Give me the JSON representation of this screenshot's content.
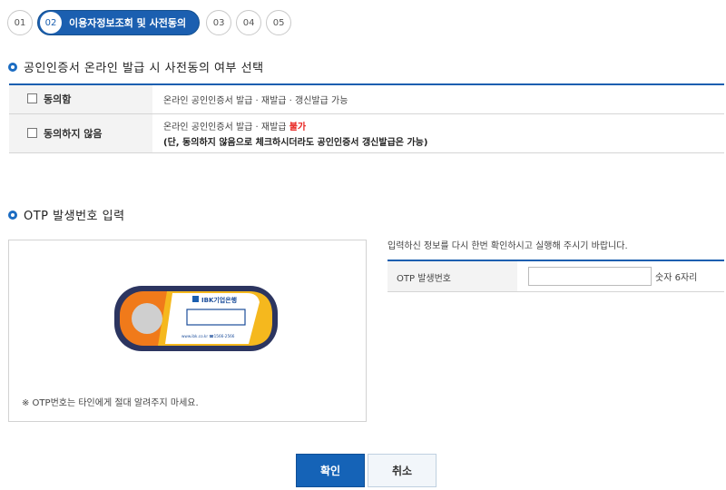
{
  "steps": {
    "s1": "01",
    "s2_num": "02",
    "s2_label": "이용자정보조회 및 사전동의",
    "s3": "03",
    "s4": "04",
    "s5": "05"
  },
  "consent": {
    "title": "공인인증서 온라인 발급 시 사전동의 여부 선택",
    "rows": [
      {
        "option": "동의함",
        "desc": "온라인 공인인증서 발급 · 재발급 · 갱신발급 가능",
        "checked": false
      },
      {
        "option": "동의하지 않음",
        "desc_prefix": "온라인 공인인증서 발급 · 재발급 ",
        "desc_emph": "불가",
        "desc_line2": "(단, 동의하지 않음으로 체크하시더라도 공인인증서 갱신발급은 가능)",
        "checked": false
      }
    ]
  },
  "otp": {
    "title": "OTP 발생번호 입력",
    "guide": "입력하신 정보를 다시 한번 확인하시고 실행해 주시기 바랍니다.",
    "field_label": "OTP 발생번호",
    "field_value": "",
    "unit": "숫자 6자리",
    "note": "※ OTP번호는 타인에게 절대 알려주지 마세요.",
    "device_brand": "IBK기업은행",
    "device_footer": "www.ibk.co.kr ☎1566-2566"
  },
  "buttons": {
    "ok": "확인",
    "cancel": "취소"
  },
  "colors": {
    "primary": "#1b5fb0",
    "emphasis": "#e8231f",
    "device_orange": "#f07a1a",
    "device_yellow": "#f5b81e",
    "device_navy": "#2c3560"
  }
}
